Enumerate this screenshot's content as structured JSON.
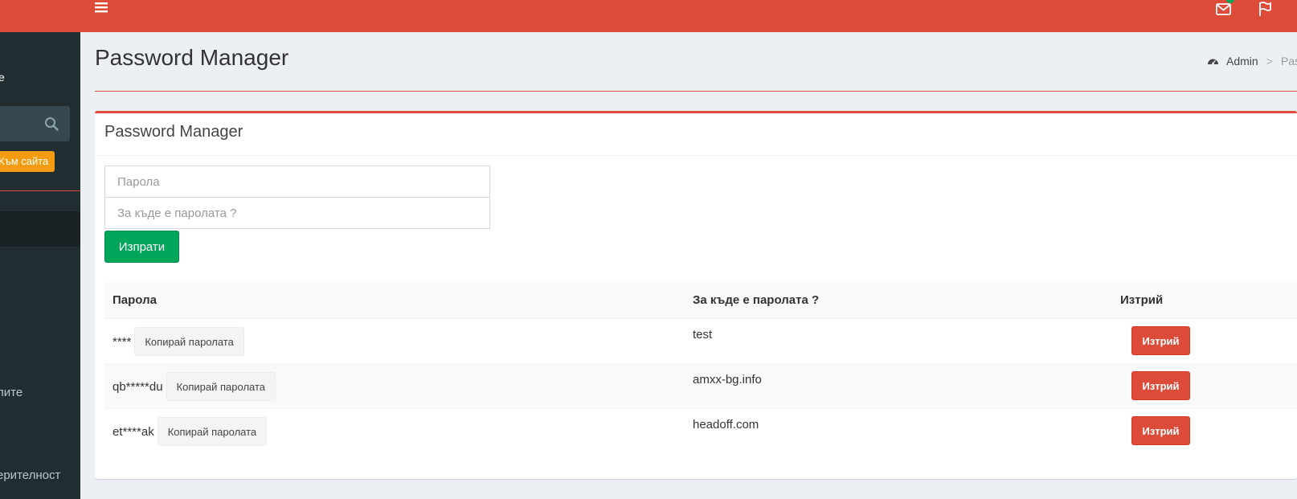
{
  "sidebar": {
    "user_text": "e",
    "site_button": "Към сайта",
    "menu_item_1": "лите",
    "menu_item_2": "ерителност"
  },
  "header": {
    "mail_badge": ""
  },
  "content_header": {
    "title": "Password Manager",
    "breadcrumb_home": "Admin",
    "breadcrumb_separator": ">",
    "breadcrumb_current": "Pass"
  },
  "box": {
    "title": "Password Manager",
    "password_placeholder": "Парола",
    "where_placeholder": "За къде е паролата ?",
    "submit_label": "Изпрати"
  },
  "table": {
    "headers": {
      "password": "Парола",
      "where": "За къде е паролата ?",
      "delete": "Изтрий"
    },
    "rows": [
      {
        "password": "****",
        "copy_label": "Копирай паролата",
        "where": "test",
        "delete_label": "Изтрий"
      },
      {
        "password": "qb*****du",
        "copy_label": "Копирай паролата",
        "where": "amxx-bg.info",
        "delete_label": "Изтрий"
      },
      {
        "password": "et****ak",
        "copy_label": "Копирай паролата",
        "where": "headoff.com",
        "delete_label": "Изтрий"
      }
    ]
  },
  "colors": {
    "accent": "#dd4b39",
    "success": "#00a65a",
    "warning": "#f39c12",
    "sidebar_bg": "#222d32"
  },
  "icons": {
    "menu": "hamburger-icon",
    "search": "search-icon",
    "mail": "envelope-icon",
    "flag": "flag-icon",
    "breadcrumb": "dashboard-icon"
  }
}
